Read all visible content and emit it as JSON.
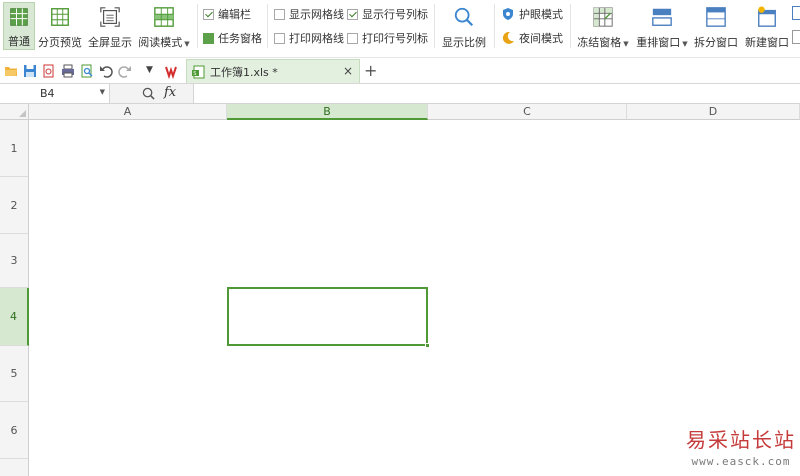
{
  "ribbon": {
    "normal": "普通",
    "page_break": "分页预览",
    "full_screen": "全屏显示",
    "reading_mode": "阅读模式",
    "edit_bar": "编辑栏",
    "task_pane": "任务窗格",
    "show_gridlines": "显示网格线",
    "show_headers": "显示行号列标",
    "print_gridlines": "打印网格线",
    "print_headers": "打印行号列标",
    "zoom": "显示比例",
    "eye_mode": "护眼模式",
    "night_mode": "夜间模式",
    "freeze_panes": "冻结窗格",
    "arrange_windows": "重排窗口",
    "split_window": "拆分窗口",
    "new_window": "新建窗口"
  },
  "checks": {
    "edit_bar": true,
    "task_pane": false,
    "show_gridlines": false,
    "show_headers": true,
    "print_gridlines": false,
    "print_headers": false
  },
  "tab": {
    "label": "工作簿1.xls *",
    "close": "×",
    "new": "+"
  },
  "formula_bar": {
    "cell_ref": "B4",
    "fx": "fx",
    "value": ""
  },
  "columns": [
    "A",
    "B",
    "C",
    "D"
  ],
  "rows": [
    "1",
    "2",
    "3",
    "4",
    "5",
    "6"
  ],
  "selection": {
    "column": "B",
    "row": "4"
  },
  "watermark": {
    "cn": "易采站长站",
    "en": "www.easck.com"
  },
  "colors": {
    "accent": "#4f9a36",
    "selected_header": "#d6e8cf",
    "tab_active": "#e3efdf",
    "watermark": "#c53a3a"
  }
}
